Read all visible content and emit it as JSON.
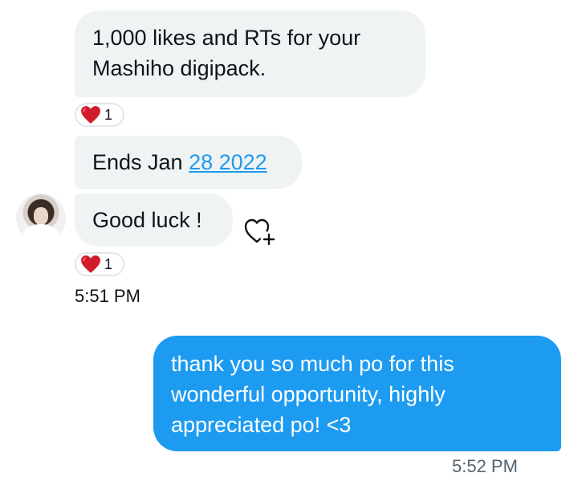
{
  "messages": [
    {
      "text": "1,000 likes and RTs for your Mashiho digipack."
    },
    {
      "text_prefix": "Ends Jan ",
      "link_text": "28 2022"
    },
    {
      "text": "Good luck !"
    }
  ],
  "reactions": [
    {
      "emoji": "heart",
      "count": "1"
    },
    {
      "emoji": "heart",
      "count": "1"
    }
  ],
  "incoming_time": "5:51 PM",
  "outgoing": {
    "text": "thank you so much po for this wonderful opportunity, highly appreciated po! <3",
    "time": "5:52 PM"
  },
  "colors": {
    "incoming_bubble": "#eff3f4",
    "outgoing_bubble": "#1d9bf0",
    "link": "#1d9bf0",
    "heart": "#e0245e"
  },
  "icons": {
    "reaction": "red-heart-icon",
    "add_reaction": "heart-plus-icon"
  }
}
